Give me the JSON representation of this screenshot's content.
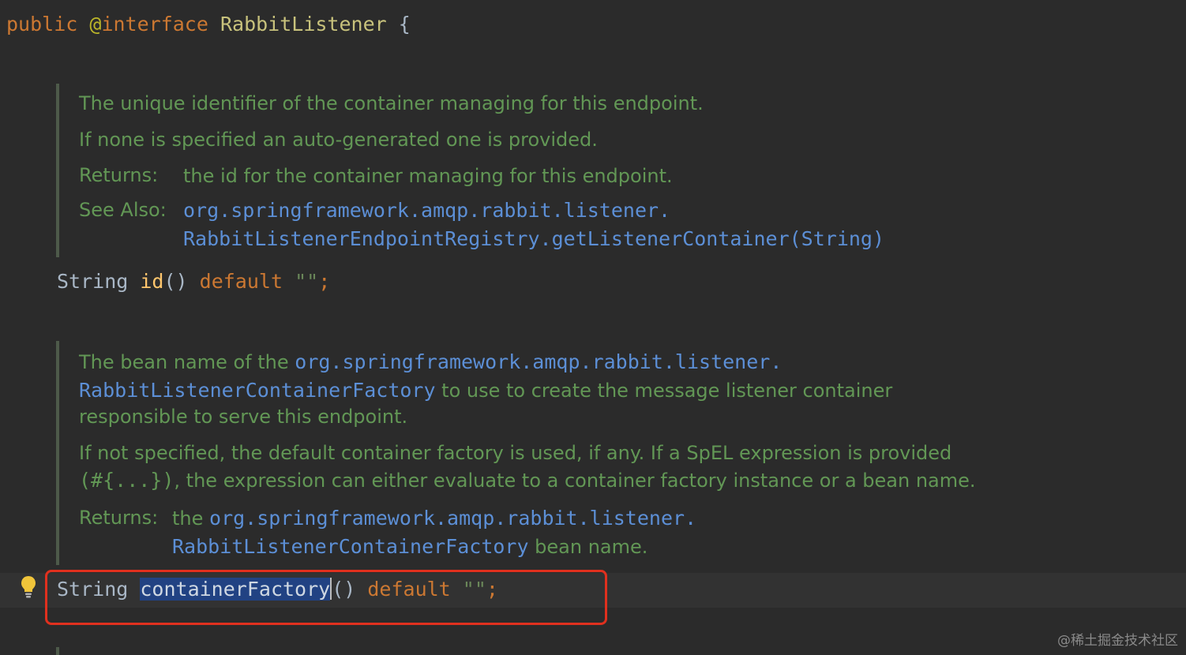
{
  "code": {
    "decl_public": "public",
    "decl_at": "@",
    "decl_interface": "interface",
    "decl_name": "RabbitListener",
    "decl_brace": "{",
    "id_type": "String",
    "id_method": "id",
    "id_parens": "()",
    "id_default": "default",
    "id_value": "\"\"",
    "id_semi": ";",
    "cf_type": "String",
    "cf_method": "containerFactory",
    "cf_parens": "()",
    "cf_default": "default",
    "cf_value": "\"\"",
    "cf_semi": ";"
  },
  "doc1": {
    "line1": "The unique identifier of the container managing for this endpoint.",
    "line2": "If none is specified an auto-generated one is provided.",
    "returns_label": "Returns:",
    "returns_text": "the id for the container managing for this endpoint.",
    "see_label": "See Also:",
    "see_link_1": "org.springframework.amqp.rabbit.listener.",
    "see_link_2": "RabbitListenerEndpointRegistry.getListenerContainer(String)"
  },
  "doc2": {
    "p1_a": "The bean name of the ",
    "p1_link1": "org.springframework.amqp.rabbit.listener.",
    "p1_link2": "RabbitListenerContainerFactory",
    "p1_b": " to use to create the message listener container",
    "p1_c": "responsible to serve this endpoint.",
    "p2_a": "If not specified, the default container factory is used, if any. If a SpEL expression is provided",
    "p2_code": "(#{...})",
    "p2_b": ", the expression can either evaluate to a container factory instance or a bean name.",
    "returns_label": "Returns:",
    "returns_a": "the ",
    "returns_link1": "org.springframework.amqp.rabbit.listener.",
    "returns_link2": "RabbitListenerContainerFactory",
    "returns_b": " bean name."
  },
  "watermark": "@稀土掘金技术社区",
  "colors": {
    "background": "#2b2b2b",
    "keyword": "#cc7832",
    "doc_text": "#629755",
    "doc_link": "#5c8fd6",
    "highlight_box": "#e0301e",
    "selection": "#214283"
  },
  "icons": {
    "gutter": "lightbulb-icon"
  }
}
